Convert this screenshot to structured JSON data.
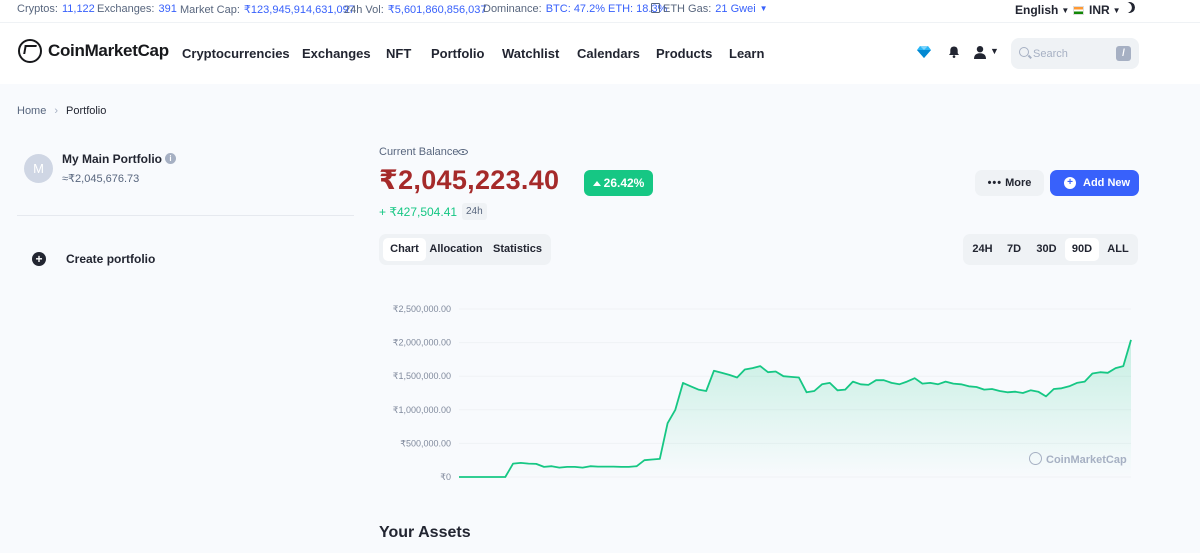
{
  "topbar": {
    "cryptos_label": "Cryptos:",
    "cryptos_value": "11,122",
    "exchanges_label": "Exchanges:",
    "exchanges_value": "391",
    "market_cap_label": "Market Cap:",
    "market_cap_value": "₹123,945,914,631,097",
    "vol_label": "24h Vol:",
    "vol_value": "₹5,601,860,856,037",
    "dominance_label": "Dominance:",
    "dominance_value": "BTC: 47.2% ETH: 18.3%",
    "gas_label": "ETH Gas:",
    "gas_value": "21 Gwei",
    "language": "English",
    "currency": "INR"
  },
  "header": {
    "logo_text": "CoinMarketCap",
    "nav": [
      "Cryptocurrencies",
      "Exchanges",
      "NFT",
      "Portfolio",
      "Watchlist",
      "Calendars",
      "Products",
      "Learn"
    ],
    "search_placeholder": "Search",
    "search_shortcut": "/"
  },
  "breadcrumb": {
    "home": "Home",
    "current": "Portfolio"
  },
  "sidebar": {
    "avatar_letter": "M",
    "portfolio_name": "My Main Portfolio",
    "portfolio_value": "≈₹2,045,676.73",
    "create_label": "Create portfolio"
  },
  "balance": {
    "label": "Current Balance",
    "value": "₹2,045,223.40",
    "change_pct": "26.42%",
    "change_value": "+ ₹427,504.41",
    "change_period": "24h",
    "more_label": "More",
    "add_label": "Add New"
  },
  "tabs": {
    "items": [
      "Chart",
      "Allocation",
      "Statistics"
    ],
    "active": "Chart"
  },
  "ranges": {
    "items": [
      "24H",
      "7D",
      "30D",
      "90D",
      "ALL"
    ],
    "active": "90D"
  },
  "chart_data": {
    "type": "area",
    "y_ticks": [
      "₹2,500,000.00",
      "₹2,000,000.00",
      "₹1,500,000.00",
      "₹1,000,000.00",
      "₹500,000.00",
      "₹0"
    ],
    "ylim": [
      0,
      2500000
    ],
    "grid": true,
    "color": "#16c784",
    "watermark": "CoinMarketCap",
    "values": [
      0,
      0,
      0,
      0,
      0,
      0,
      0,
      200000,
      210000,
      200000,
      195000,
      150000,
      160000,
      140000,
      150000,
      150000,
      140000,
      160000,
      155000,
      155000,
      155000,
      150000,
      150000,
      160000,
      250000,
      260000,
      270000,
      800000,
      1000000,
      1400000,
      1350000,
      1300000,
      1280000,
      1580000,
      1550000,
      1520000,
      1480000,
      1600000,
      1620000,
      1650000,
      1560000,
      1570000,
      1500000,
      1490000,
      1480000,
      1260000,
      1280000,
      1380000,
      1400000,
      1290000,
      1300000,
      1420000,
      1380000,
      1370000,
      1440000,
      1440000,
      1400000,
      1380000,
      1420000,
      1470000,
      1390000,
      1400000,
      1380000,
      1420000,
      1390000,
      1380000,
      1350000,
      1340000,
      1300000,
      1310000,
      1280000,
      1260000,
      1270000,
      1250000,
      1290000,
      1270000,
      1200000,
      1310000,
      1320000,
      1350000,
      1400000,
      1420000,
      1540000,
      1560000,
      1550000,
      1620000,
      1650000,
      2040000
    ]
  },
  "assets": {
    "title": "Your Assets"
  }
}
